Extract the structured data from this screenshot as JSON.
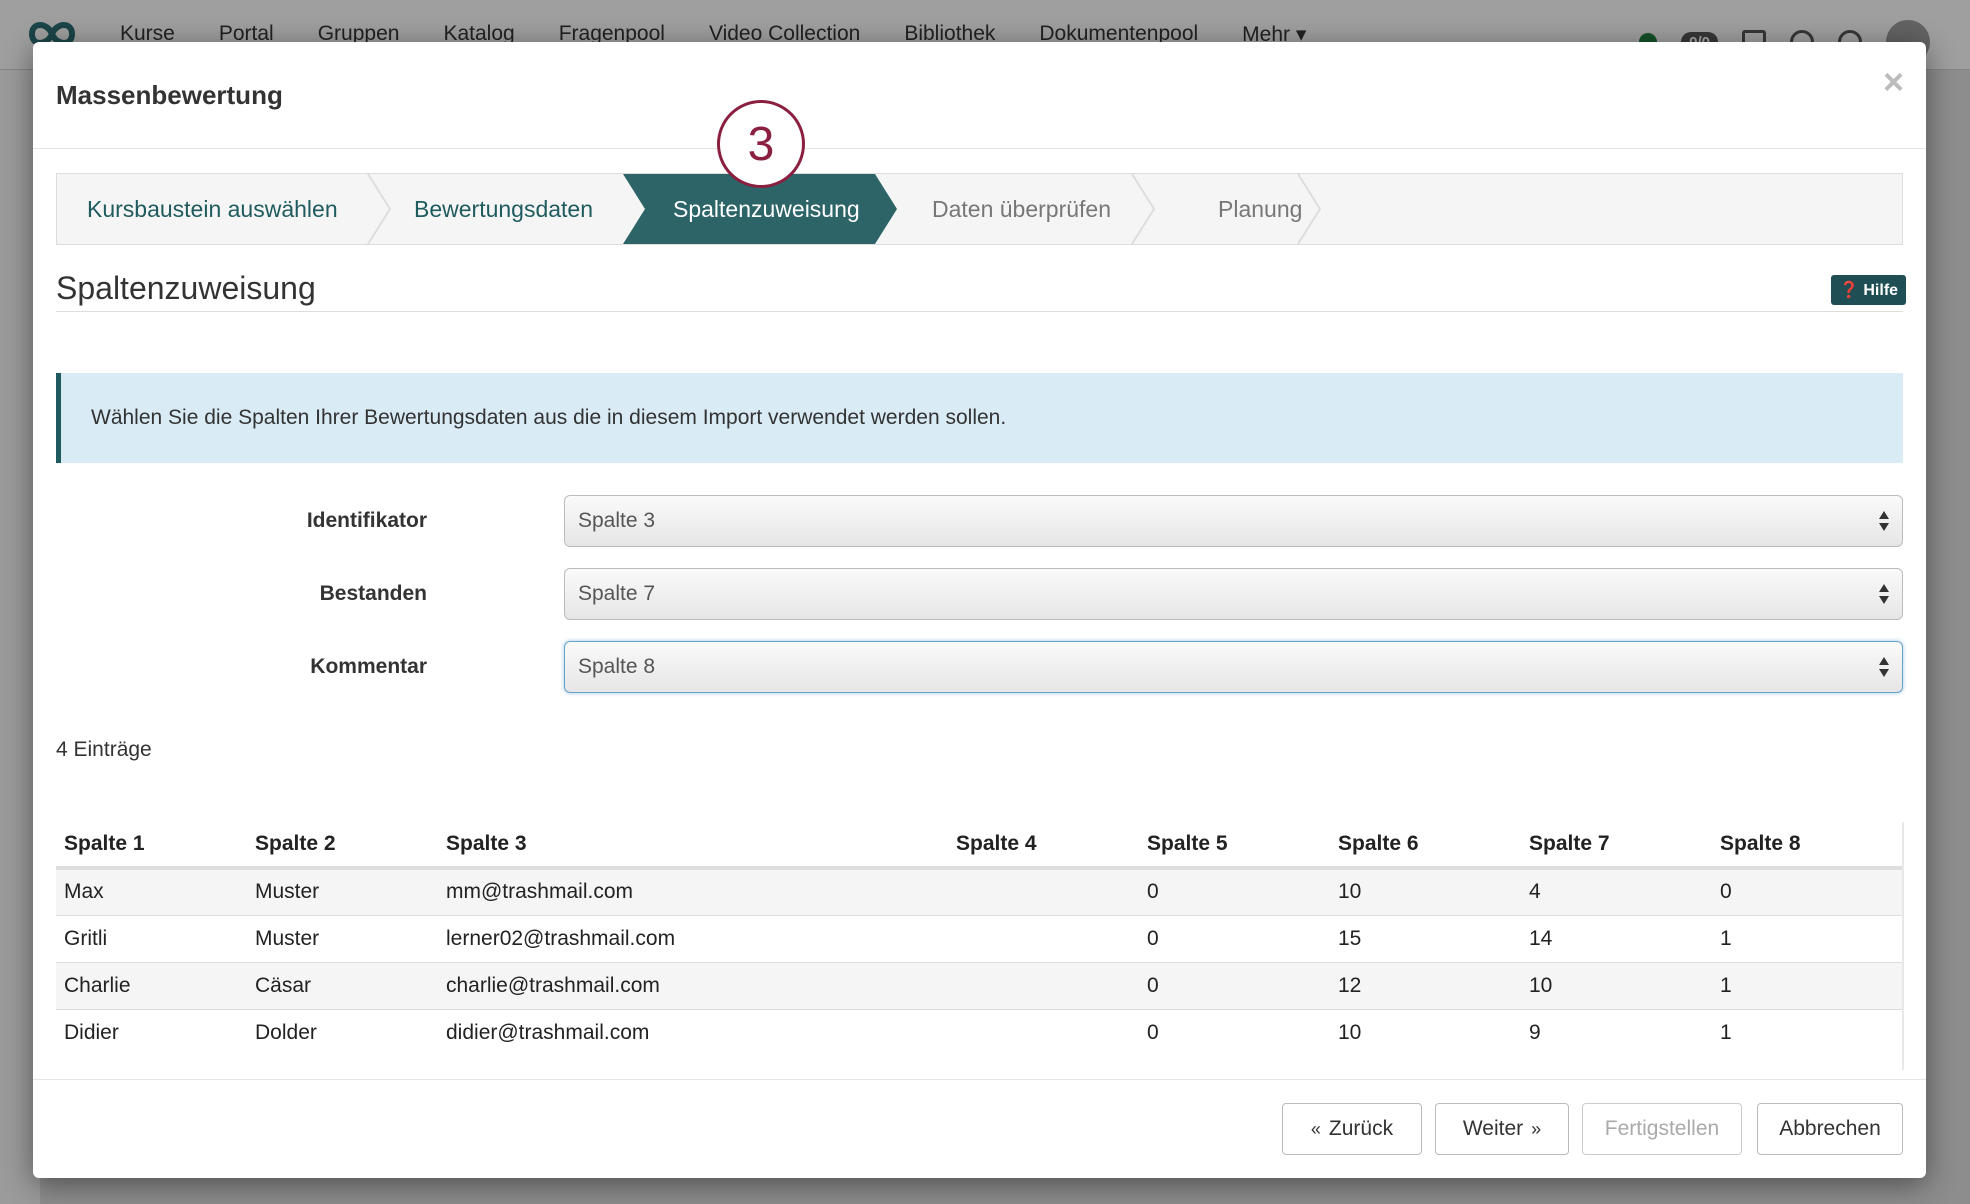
{
  "topnav": {
    "items": [
      "Kurse",
      "Portal",
      "Gruppen",
      "Katalog",
      "Fragenpool",
      "Video Collection",
      "Bibliothek",
      "Dokumentenpool",
      "Mehr ▾"
    ],
    "badge": "0/0"
  },
  "modal": {
    "title": "Massenbewertung",
    "close": "×"
  },
  "wizard": {
    "step_number": "3",
    "steps": [
      {
        "label": "Kursbaustein auswählen",
        "state": "done"
      },
      {
        "label": "Bewertungsdaten",
        "state": "done"
      },
      {
        "label": "Spaltenzuweisung",
        "state": "active"
      },
      {
        "label": "Daten überprüfen",
        "state": "todo"
      },
      {
        "label": "Planung",
        "state": "todo"
      }
    ]
  },
  "section": {
    "title": "Spaltenzuweisung",
    "help": "Hilfe",
    "info": "Wählen Sie die Spalten Ihrer Bewertungsdaten aus die in diesem Import verwendet werden sollen."
  },
  "form": {
    "identifikator": {
      "label": "Identifikator",
      "value": "Spalte 3"
    },
    "bestanden": {
      "label": "Bestanden",
      "value": "Spalte 7"
    },
    "kommentar": {
      "label": "Kommentar",
      "value": "Spalte 8"
    }
  },
  "table": {
    "count": "4 Einträge",
    "headers": [
      "Spalte 1",
      "Spalte 2",
      "Spalte 3",
      "Spalte 4",
      "Spalte 5",
      "Spalte 6",
      "Spalte 7",
      "Spalte 8"
    ],
    "rows": [
      [
        "Max",
        "Muster",
        "mm@trashmail.com",
        "",
        "0",
        "10",
        "4",
        "0"
      ],
      [
        "Gritli",
        "Muster",
        "lerner02@trashmail.com",
        "",
        "0",
        "15",
        "14",
        "1"
      ],
      [
        "Charlie",
        "Cäsar",
        "charlie@trashmail.com",
        "",
        "0",
        "12",
        "10",
        "1"
      ],
      [
        "Didier",
        "Dolder",
        "didier@trashmail.com",
        "",
        "0",
        "10",
        "9",
        "1"
      ]
    ]
  },
  "buttons": {
    "back": "Zurück",
    "next": "Weiter",
    "finish": "Fertigstellen",
    "cancel": "Abbrechen"
  },
  "colors": {
    "accent": "#1f5b5e",
    "badge": "#8b1f3f",
    "info_bg": "#d9ebf5"
  }
}
